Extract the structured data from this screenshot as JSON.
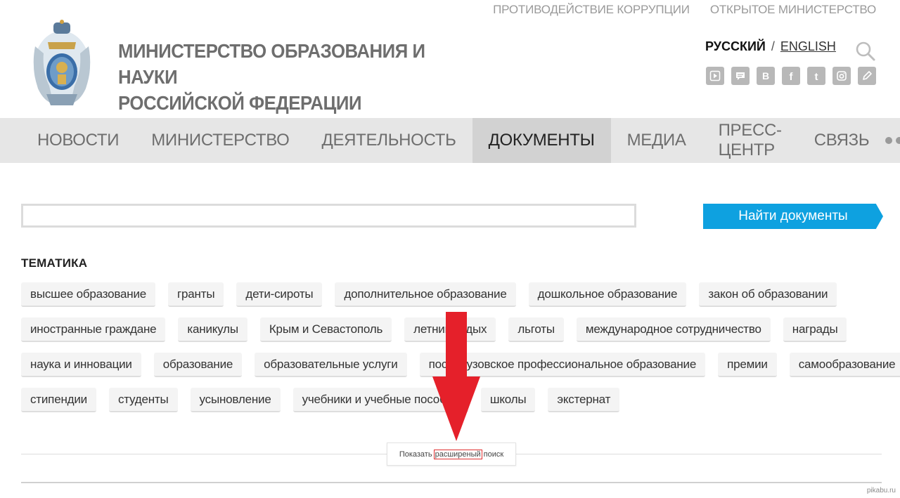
{
  "top_links": [
    "ПРОТИВОДЕЙСТВИЕ КОРРУПЦИИ",
    "ОТКРЫТОЕ МИНИСТЕРСТВО"
  ],
  "header": {
    "title_line1": "МИНИСТЕРСТВО ОБРАЗОВАНИЯ И НАУКИ",
    "title_line2": "РОССИЙСКОЙ ФЕДЕРАЦИИ",
    "lang_current": "РУССКИЙ",
    "lang_separator": "/",
    "lang_other": "ENGLISH"
  },
  "socials": [
    "video-icon",
    "chat-icon",
    "vk-icon",
    "facebook-icon",
    "twitter-icon",
    "instagram-icon",
    "livejournal-icon"
  ],
  "nav": {
    "items": [
      "НОВОСТИ",
      "МИНИСТЕРСТВО",
      "ДЕЯТЕЛЬНОСТЬ",
      "ДОКУМЕНТЫ",
      "МЕДИА",
      "ПРЕСС-ЦЕНТР",
      "СВЯЗЬ"
    ],
    "active": "ДОКУМЕНТЫ"
  },
  "search": {
    "value": "",
    "button_label": "Найти документы"
  },
  "topics": {
    "title": "ТЕМАТИКА",
    "rows": [
      [
        "высшее образование",
        "гранты",
        "дети-сироты",
        "дополнительное образование",
        "дошкольное образование",
        "закон об образовании"
      ],
      [
        "иностранные граждане",
        "каникулы",
        "Крым и Севастополь",
        "летний отдых",
        "льготы",
        "международное сотрудничество",
        "награды"
      ],
      [
        "наука и инновации",
        "образование",
        "образовательные услуги",
        "послевузовское профессиональное образование",
        "премии",
        "самообразование"
      ],
      [
        "стипендии",
        "студенты",
        "усыновление",
        "учебники и учебные пособия",
        "школы",
        "экстернат"
      ]
    ]
  },
  "advanced": {
    "prefix": "Показать",
    "highlight": "расширеный",
    "suffix": "поиск"
  },
  "watermark": "pikabu.ru",
  "colors": {
    "accent": "#0ea1e0",
    "nav_bg": "#e6e6e6",
    "nav_active_bg": "#d2d2d2",
    "arrow": "#e5202a",
    "highlight_border": "#e03030"
  }
}
